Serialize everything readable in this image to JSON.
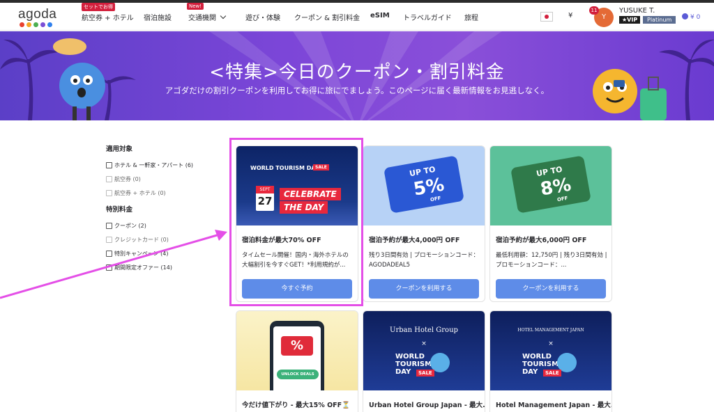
{
  "header": {
    "logo": "agoda",
    "logo_dots": [
      "#e8402e",
      "#f5a623",
      "#4caf50",
      "#7b4fd6",
      "#2f80ed"
    ],
    "nav": [
      {
        "label": "航空券 + ホテル",
        "badge": "セットでお得"
      },
      {
        "label": "宿泊施設"
      },
      {
        "label": "交通機関",
        "badge": "New!"
      },
      {
        "label": "遊び・体験"
      },
      {
        "label": "クーポン & 割引料金"
      },
      {
        "label": "eSIM"
      },
      {
        "label": "トラベルガイド"
      },
      {
        "label": "旅程"
      }
    ],
    "currency": "¥",
    "notifications": "11",
    "avatar_letter": "Y",
    "username": "YUSUKE T.",
    "vip": "★VIP",
    "tier": "Platinum",
    "wallet": "¥ 0"
  },
  "hero": {
    "title": "<特集>今日のクーポン・割引料金",
    "subtitle": "アゴダだけの割引クーポンを利用してお得に旅にでましょう。このページに届く最新情報をお見逃しなく。"
  },
  "filters": {
    "groups": [
      {
        "title": "適用対象",
        "items": [
          {
            "label": "ホテル & 一軒家・アパート (6)",
            "disabled": false
          },
          {
            "label": "航空券 (0)",
            "disabled": true
          },
          {
            "label": "航空券 + ホテル (0)",
            "disabled": true
          }
        ]
      },
      {
        "title": "特別料金",
        "items": [
          {
            "label": "クーポン (2)",
            "disabled": false
          },
          {
            "label": "クレジットカード (0)",
            "disabled": true
          },
          {
            "label": "特別キャンペーン (4)",
            "disabled": false
          },
          {
            "label": "期間限定オファー (14)",
            "disabled": false
          }
        ]
      }
    ]
  },
  "cards": [
    {
      "img_text_1": "WORLD TOURISM DAY",
      "img_badge": "SALE",
      "img_month": "SEPT",
      "img_day": "27",
      "img_text_2": "CELEBRATE",
      "img_text_3": "THE DAY",
      "title": "宿泊料金が最大70% OFF",
      "desc": "タイムセール開催！国内・海外ホテルの大幅割引を今すぐGET！*利用規約が...",
      "button": "今すぐ予約"
    },
    {
      "img_up": "UP TO",
      "img_pct": "5%",
      "img_off": "OFF",
      "title": "宿泊予約が最大4,000円 OFF",
      "desc": "残り3日間有効 | プロモーションコード：AGODADEAL5",
      "button": "クーポンを利用する"
    },
    {
      "img_up": "UP TO",
      "img_pct": "8%",
      "img_off": "OFF",
      "title": "宿泊予約が最大6,000円 OFF",
      "desc": "最低利用額：12,750円 | 残り3日間有効 | プロモーションコード：...",
      "button": "クーポンを利用する"
    },
    {
      "img_pct": "%",
      "img_pill": "UNLOCK DEALS",
      "title": "今だけ値下がり - 最大15% OFF⏳"
    },
    {
      "img_brand": "Urban Hotel Group",
      "img_x": "×",
      "img_w1": "WORLD",
      "img_w2": "TOURISM",
      "img_w3": "DAY",
      "img_sale": "SALE",
      "title": "Urban Hotel Group Japan - 最大..."
    },
    {
      "img_brand": "HOTEL MANAGEMENT JAPAN",
      "img_x": "×",
      "img_w1": "WORLD",
      "img_w2": "TOURISM",
      "img_w3": "DAY",
      "img_sale": "SALE",
      "title": "Hotel Management Japan - 最大..."
    }
  ],
  "colors": {
    "accent_button": "#5e8ce8",
    "highlight": "#e44fe7",
    "hero": "#7c46d8"
  }
}
